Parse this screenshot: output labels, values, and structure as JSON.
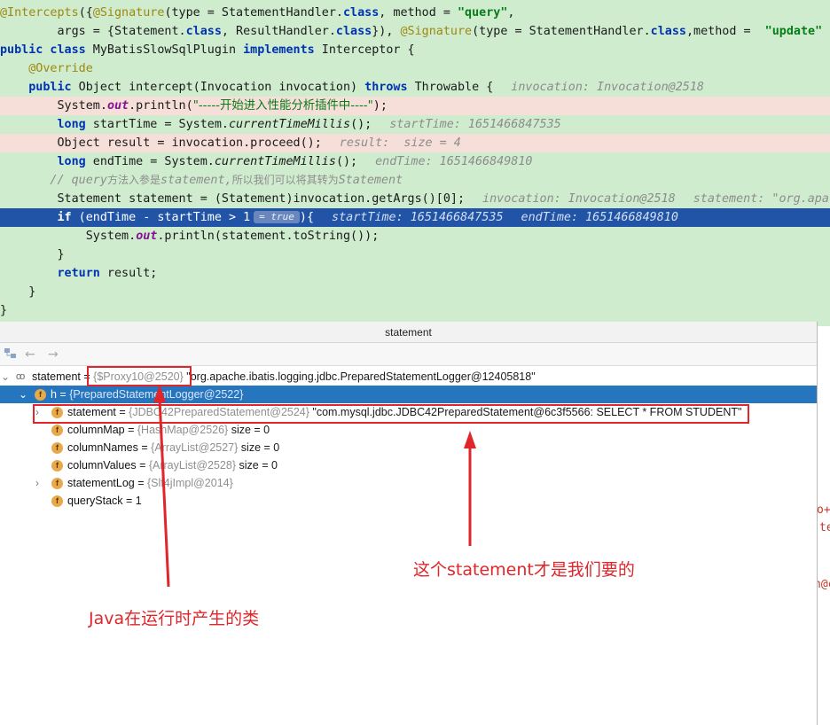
{
  "editor": {
    "l1_a1": "@Intercepts",
    "l1_p1": "({",
    "l1_a2": "@Signature",
    "l1_p2": "(type = StatementHandler.",
    "l1_k1": "class",
    "l1_p3": ", method = ",
    "l1_s1": "\"query\"",
    "l1_p4": ",",
    "l2_p1": "        args = {Statement.",
    "l2_k1": "class",
    "l2_p2": ", ResultHandler.",
    "l2_k2": "class",
    "l2_p3": "}), ",
    "l2_a1": "@Signature",
    "l2_p4": "(type = StatementHandler.",
    "l2_k3": "class",
    "l2_p5": ",method =  ",
    "l2_s1": "\"update\"",
    "l2_p6": " ,",
    "l3_k1": "public class",
    "l3_p1": " MyBatisSlowSqlPlugin ",
    "l3_k2": "implements",
    "l3_p2": " Interceptor {",
    "l4_a1": "    @Override",
    "l5_k1": "    public",
    "l5_p1": " Object intercept(Invocation invocation) ",
    "l5_k2": "throws",
    "l5_p2": " Throwable {",
    "l5_h1": "invocation: Invocation@2518",
    "l6_p1": "        System.",
    "l6_f1": "out",
    "l6_p2": ".println(",
    "l6_s1": "\"-----开始进入性能分析插件中----\"",
    "l6_p3": ");",
    "l7_k1": "        long",
    "l7_p1": " startTime = System.",
    "l7_i1": "currentTimeMillis",
    "l7_p2": "();",
    "l7_h1": "startTime: 1651466847535",
    "l8_p1": "        Object result = invocation.proceed();",
    "l8_h1": "result:  size = 4",
    "l9_k1": "        long",
    "l9_p1": " endTime = System.",
    "l9_i1": "currentTimeMillis",
    "l9_p2": "();",
    "l9_h1": "endTime: 1651466849810",
    "l10_c1": "       // query",
    "l10_c2": "方法入参是",
    "l10_c3": "statement,",
    "l10_c4": "所以我们可以将其转为",
    "l10_c5": "Statement",
    "l11_p1": "        Statement statement = (Statement)invocation.getArgs()[0];",
    "l11_h1": "invocation: Invocation@2518",
    "l11_h2": "statement: \"org.apa",
    "l12_k1": "        if",
    "l12_p1": " (endTime - startTime > 1",
    "l12_b1": "= true",
    "l12_p2": "){",
    "l12_h1": "startTime: 1651466847535",
    "l12_h2": "endTime: 1651466849810",
    "l13_p1": "            System.",
    "l13_f1": "out",
    "l13_p2": ".println(statement.toString());",
    "l14_p1": "        }",
    "l15_k1": "        return",
    "l15_p1": " result;",
    "l16_p1": "    }",
    "l17_p1": "}"
  },
  "pane": {
    "title": "statement",
    "back_icon": "←",
    "forward_icon": "→"
  },
  "tree": [
    {
      "name": "statement",
      "eq": " = ",
      "ref": "{$Proxy10@2520}",
      "val": " \"org.apache.ibatis.logging.jdbc.PreparedStatementLogger@12405818\""
    },
    {
      "name": "h",
      "eq": " = ",
      "ref": "{PreparedStatementLogger@2522}",
      "val": ""
    },
    {
      "name": "statement",
      "eq": " = ",
      "ref": "{JDBC42PreparedStatement@2524}",
      "val": " \"com.mysql.jdbc.JDBC42PreparedStatement@6c3f5566: SELECT * FROM STUDENT\""
    },
    {
      "name": "columnMap",
      "eq": " = ",
      "ref": "{HashMap@2526}",
      "val": "  size = 0"
    },
    {
      "name": "columnNames",
      "eq": " = ",
      "ref": "{ArrayList@2527}",
      "val": "  size = 0"
    },
    {
      "name": "columnValues",
      "eq": " = ",
      "ref": "{ArrayList@2528}",
      "val": "  size = 0"
    },
    {
      "name": "statementLog",
      "eq": " = ",
      "ref": "{Slf4jImpl@2014}",
      "val": ""
    },
    {
      "name": "queryStack",
      "eq": " = ",
      "ref": "",
      "val": "1"
    }
  ],
  "annotations": {
    "note_statement": "这个statement才是我们要的",
    "note_proxy": "Java在运行时产生的类",
    "color": "#e0262b"
  },
  "background_fragments": {
    "f1": "o+",
    "f2": "te",
    "f3": "n@c"
  }
}
